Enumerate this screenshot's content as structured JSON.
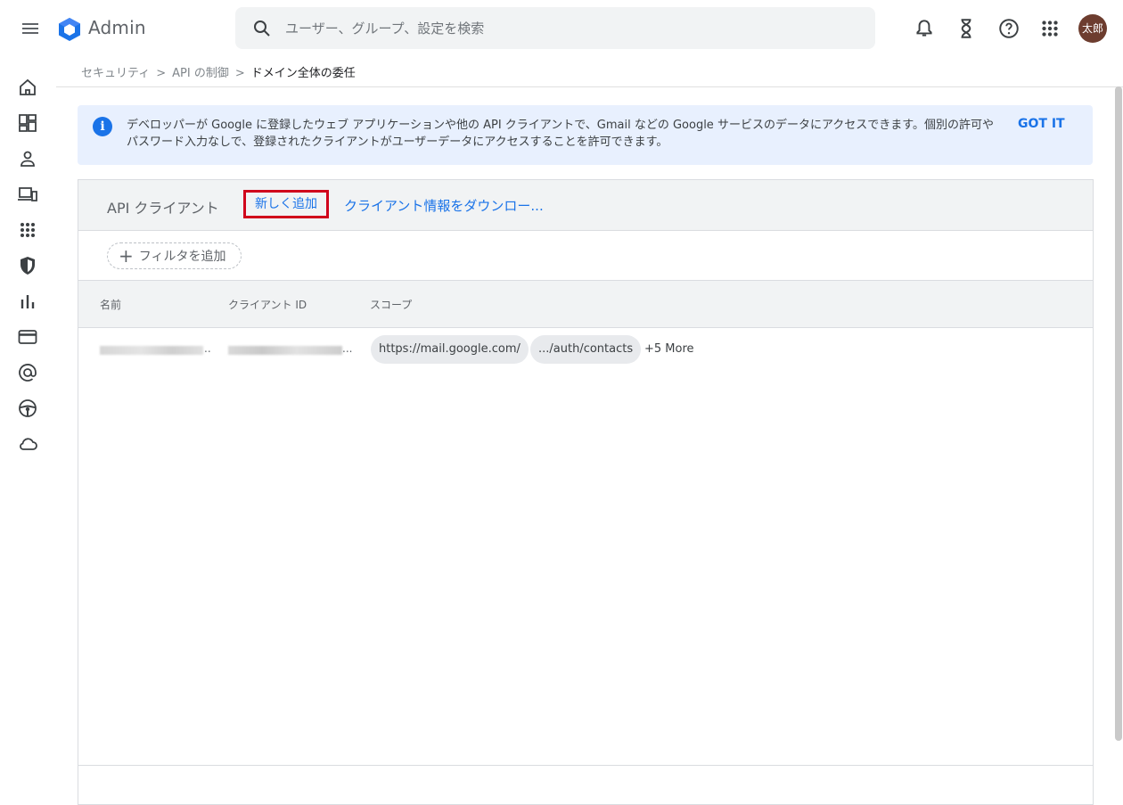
{
  "header": {
    "app_name": "Admin",
    "search_placeholder": "ユーザー、グループ、設定を検索",
    "avatar_initials": "太郎"
  },
  "breadcrumb": {
    "items": [
      "セキュリティ",
      "API の制御",
      "ドメイン全体の委任"
    ],
    "separator": ">"
  },
  "banner": {
    "text": "デベロッパーが Google に登録したウェブ アプリケーションや他の API クライアントで、Gmail などの Google サービスのデータにアクセスできます。個別の許可やパスワード入力なしで、登録されたクライアントがユーザーデータにアクセスすることを許可できます。",
    "action": "GOT IT"
  },
  "card": {
    "title": "API クライアント",
    "add_new": "新しく追加",
    "download": "クライアント情報をダウンロー..."
  },
  "filter": {
    "label": "フィルタを追加"
  },
  "table": {
    "columns": [
      "名前",
      "クライアント ID",
      "スコープ"
    ],
    "rows": [
      {
        "name_suffix": "..",
        "client_id_suffix": "...",
        "scopes": [
          "https://mail.google.com/",
          ".../auth/contacts"
        ],
        "more": "+5 More"
      }
    ]
  },
  "colors": {
    "accent": "#1a73e8",
    "highlight_border": "#d0021b",
    "banner_bg": "#e8f0fe",
    "avatar_bg": "#6d3d2f"
  }
}
